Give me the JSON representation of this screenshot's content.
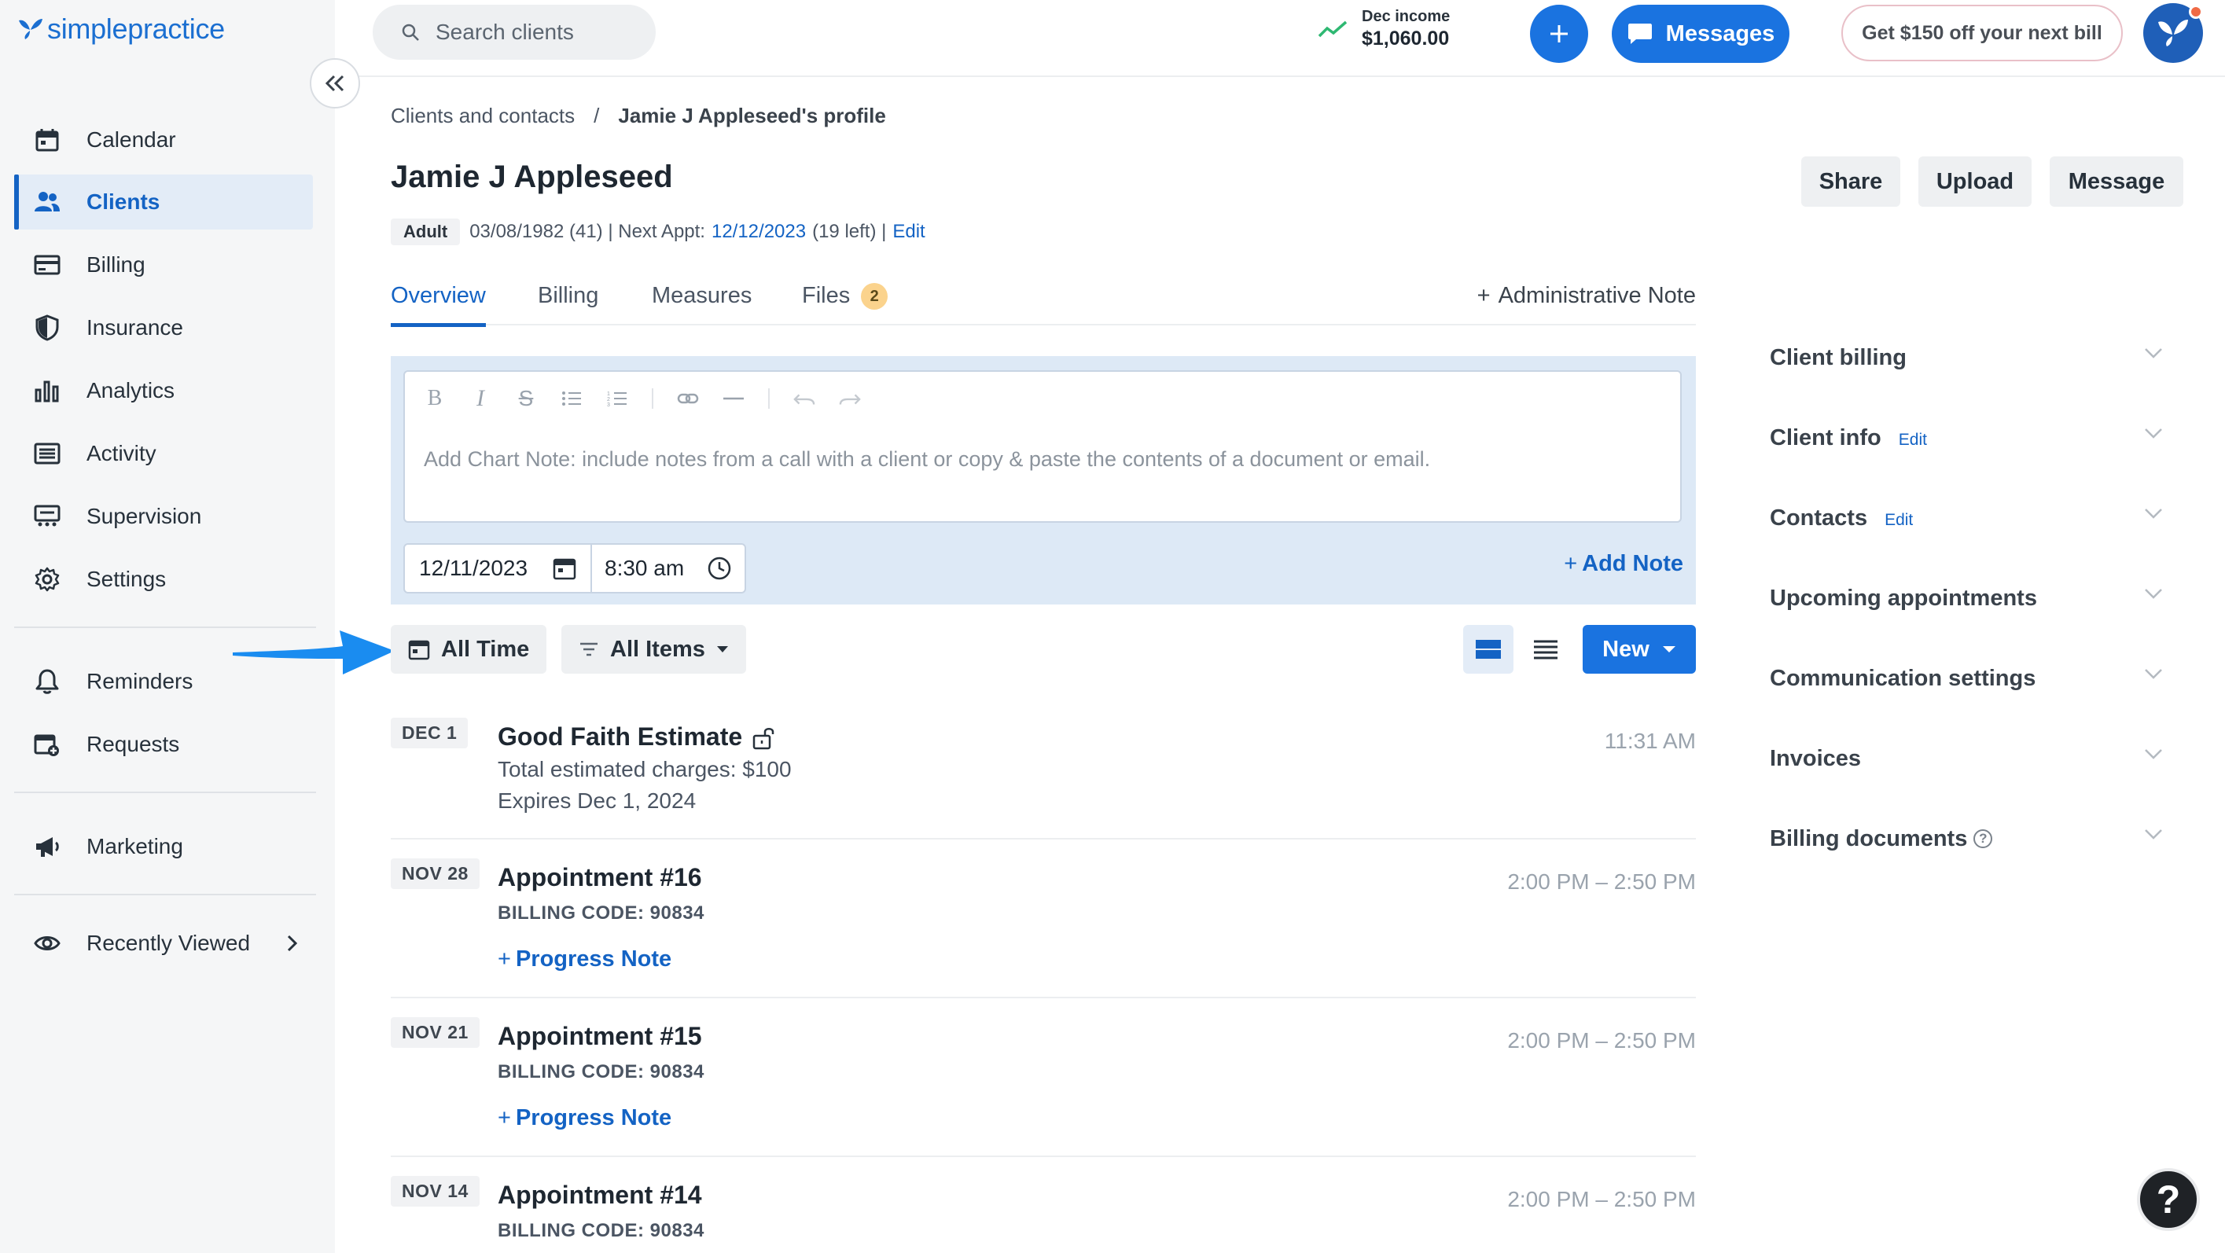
{
  "brand": {
    "logo_text": "simplepractice"
  },
  "sidebar": {
    "items": [
      {
        "label": "Calendar",
        "icon": "calendar-icon"
      },
      {
        "label": "Clients",
        "icon": "users-icon",
        "active": true
      },
      {
        "label": "Billing",
        "icon": "credit-card-icon"
      },
      {
        "label": "Insurance",
        "icon": "shield-icon"
      },
      {
        "label": "Analytics",
        "icon": "bar-chart-icon"
      },
      {
        "label": "Activity",
        "icon": "list-icon"
      },
      {
        "label": "Supervision",
        "icon": "supervision-icon"
      },
      {
        "label": "Settings",
        "icon": "gear-icon"
      },
      {
        "label": "Reminders",
        "icon": "bell-icon"
      },
      {
        "label": "Requests",
        "icon": "calendar-plus-icon"
      },
      {
        "label": "Marketing",
        "icon": "megaphone-icon"
      },
      {
        "label": "Recently Viewed",
        "icon": "eye-icon"
      }
    ]
  },
  "topbar": {
    "search_placeholder": "Search clients",
    "income_label": "Dec income",
    "income_value": "$1,060.00",
    "messages_label": "Messages",
    "promo_label": "Get $150 off your next bill"
  },
  "breadcrumb": {
    "parent": "Clients and contacts",
    "separator": "/",
    "current": "Jamie J Appleseed's profile"
  },
  "client": {
    "name": "Jamie J Appleseed",
    "badge": "Adult",
    "dob": "03/08/1982 (41) | Next Appt:",
    "next_appt": "12/12/2023",
    "remaining": "(19 left) |",
    "edit_label": "Edit"
  },
  "header_actions": {
    "share": "Share",
    "upload": "Upload",
    "message": "Message"
  },
  "tabs": [
    {
      "label": "Overview",
      "active": true
    },
    {
      "label": "Billing"
    },
    {
      "label": "Measures"
    },
    {
      "label": "Files",
      "count": "2"
    }
  ],
  "admin_note_label": "Administrative Note",
  "editor": {
    "placeholder": "Add Chart Note: include notes from a call with a client or copy & paste the contents of a document or email.",
    "date": "12/11/2023",
    "time": "8:30 am",
    "add_note_label": "Add Note"
  },
  "filters": {
    "time_label": "All Time",
    "items_label": "All Items",
    "new_label": "New"
  },
  "entries": [
    {
      "date": "DEC 1",
      "title": "Good Faith Estimate",
      "line1": "Total estimated charges: $100",
      "line2": "Expires Dec 1, 2024",
      "time": "11:31 AM"
    },
    {
      "date": "NOV 28",
      "title": "Appointment #16",
      "code": "BILLING CODE: 90834",
      "link": "Progress Note",
      "time": "2:00 PM – 2:50 PM"
    },
    {
      "date": "NOV 21",
      "title": "Appointment #15",
      "code": "BILLING CODE: 90834",
      "link": "Progress Note",
      "time": "2:00 PM – 2:50 PM"
    },
    {
      "date": "NOV 14",
      "title": "Appointment #14",
      "code": "BILLING CODE: 90834",
      "time": "2:00 PM – 2:50 PM"
    }
  ],
  "right_panel": {
    "sections": [
      {
        "title": "Client billing"
      },
      {
        "title": "Client info",
        "edit": "Edit"
      },
      {
        "title": "Contacts",
        "edit": "Edit"
      },
      {
        "title": "Upcoming appointments"
      },
      {
        "title": "Communication settings"
      },
      {
        "title": "Invoices"
      },
      {
        "title": "Billing documents",
        "help": "?"
      }
    ]
  },
  "help_button": "?",
  "colors": {
    "accent": "#1a73e0",
    "link": "#1463c4",
    "sidebar_bg": "#f5f6f7",
    "arrow": "#1a8cf0"
  }
}
